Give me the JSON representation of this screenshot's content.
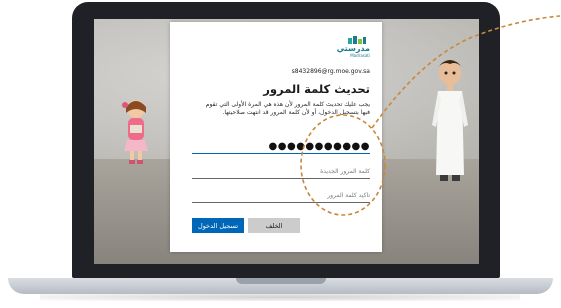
{
  "dialog": {
    "logo_text": "مدرستي",
    "logo_sub": "Madrasati",
    "email": "s8432896@rg.moe.gov.sa",
    "title": "تحديث كلمة المرور",
    "description": "يجب عليك تحديث كلمة المرور لأن هذه هي المرة الأولى التي تقوم فيها بتسجيل الدخول، أو لأن كلمة المرور قد انتهت صلاحيتها.",
    "current_password_value": "●●●●●●●●●●●",
    "new_password_placeholder": "كلمة المرور الجديدة",
    "confirm_password_placeholder": "تأكيد كلمة المرور",
    "back_label": "الخلف",
    "signin_label": "تسجيل الدخول"
  },
  "colors": {
    "primary_button": "#0067b8",
    "secondary_button": "#cccccc",
    "logo": "#1f7a8c",
    "annotation": "#c9883e"
  }
}
